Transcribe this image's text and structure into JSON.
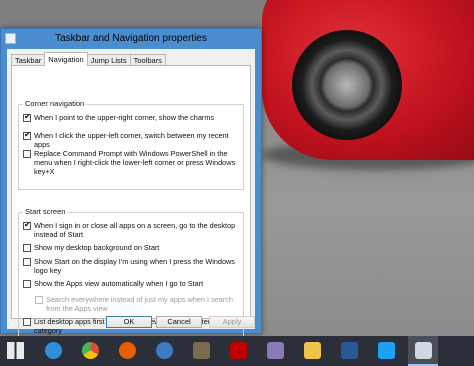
{
  "window": {
    "title": "Taskbar and Navigation properties"
  },
  "tabs": [
    {
      "label": "Taskbar",
      "active": false
    },
    {
      "label": "Navigation",
      "active": true
    },
    {
      "label": "Jump Lists",
      "active": false
    },
    {
      "label": "Toolbars",
      "active": false
    }
  ],
  "corner_navigation": {
    "label": "Corner navigation",
    "options": [
      {
        "label": "When I point to the upper-right corner, show the charms",
        "checked": true,
        "enabled": true
      },
      {
        "label": "When I click the upper-left corner, switch between my recent apps",
        "checked": true,
        "enabled": true
      },
      {
        "label": "Replace Command Prompt with Windows PowerShell in the menu when I right-click the lower-left corner or press Windows key+X",
        "checked": false,
        "enabled": true
      }
    ]
  },
  "start_screen": {
    "label": "Start screen",
    "options": [
      {
        "label": "When I sign in or close all apps on a screen, go to the desktop instead of Start",
        "checked": true,
        "enabled": true
      },
      {
        "label": "Show my desktop background on Start",
        "checked": false,
        "enabled": true
      },
      {
        "label": "Show Start on the display I'm using when I press the Windows logo key",
        "checked": false,
        "enabled": true
      },
      {
        "label": "Show the Apps view automatically when I go to Start",
        "checked": false,
        "enabled": true
      },
      {
        "label": "Search everywhere instead of just my apps when I search from the Apps view",
        "checked": false,
        "enabled": false
      },
      {
        "label": "List desktop apps first in the Apps view when it's sorted by category",
        "checked": false,
        "enabled": true
      }
    ]
  },
  "buttons": {
    "ok": "OK",
    "cancel": "Cancel",
    "apply": "Apply"
  },
  "taskbar": {
    "items": [
      {
        "icon": "windows-logo-icon",
        "color": "#ffffff"
      },
      {
        "icon": "internet-explorer-icon",
        "color": "#2e8fd8"
      },
      {
        "icon": "chrome-icon",
        "color": "#dd4b39"
      },
      {
        "icon": "firefox-icon",
        "color": "#e66000"
      },
      {
        "icon": "thunderbird-icon",
        "color": "#3d7bc4"
      },
      {
        "icon": "gimp-icon",
        "color": "#7a6a4f"
      },
      {
        "icon": "filezilla-icon",
        "color": "#bf0000"
      },
      {
        "icon": "pidgin-icon",
        "color": "#8a7bb8"
      },
      {
        "icon": "file-explorer-icon",
        "color": "#f0c34e"
      },
      {
        "icon": "word-icon",
        "color": "#2b5797"
      },
      {
        "icon": "twitter-icon",
        "color": "#1da1f2"
      },
      {
        "icon": "control-panel-icon",
        "color": "#cfd8e3"
      }
    ]
  }
}
